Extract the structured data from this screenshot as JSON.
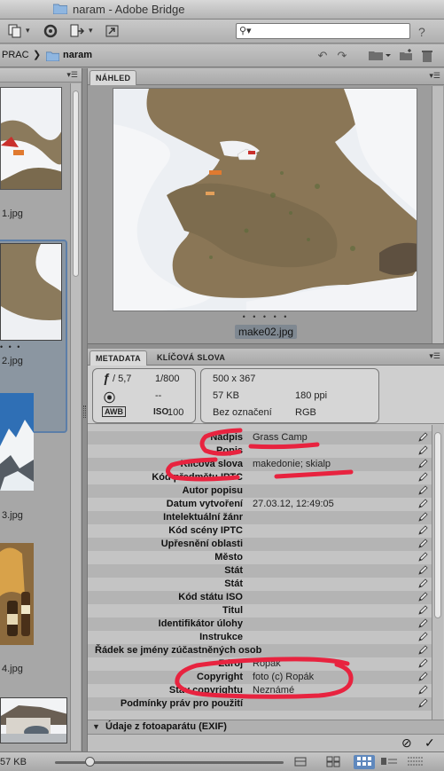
{
  "window": {
    "title": "naram - Adobe Bridge",
    "help_glyph": "?"
  },
  "toolbar": {
    "search_placeholder": "",
    "search_glyph": "⚲▾"
  },
  "path": {
    "parent": "PRAC",
    "separator": "❯",
    "current": "naram"
  },
  "content": {
    "thumbnails": [
      {
        "caption": "1.jpg"
      },
      {
        "caption": "2.jpg"
      },
      {
        "caption": "3.jpg"
      },
      {
        "caption": "4.jpg"
      }
    ],
    "selected_dots": "• • •"
  },
  "preview": {
    "tab_label": "NÁHLED",
    "dots": "• • • • •",
    "caption": "make02.jpg"
  },
  "metadata": {
    "tabs": [
      "METADATA",
      "KLÍČOVÁ SLOVA"
    ],
    "camera": {
      "aperture_icon": "ƒ",
      "aperture": "/ 5,7",
      "shutter": "1/800",
      "metering_icon": "⦿",
      "metering_value": "--",
      "wb_icon": "AWB",
      "iso_label": "ISO",
      "iso_value": "100"
    },
    "file": {
      "dimensions": "500 x 367",
      "size": "57 KB",
      "resolution": "180 ppi",
      "label": "Bez označení",
      "color_mode": "RGB"
    },
    "rows": [
      {
        "label": "Nadpis",
        "value": "Grass Camp"
      },
      {
        "label": "Popis",
        "value": ""
      },
      {
        "label": "Klíčová slova",
        "value": "makedonie; skialp"
      },
      {
        "label": "Kód předmětu IPTC",
        "value": ""
      },
      {
        "label": "Autor popisu",
        "value": ""
      },
      {
        "label": "Datum vytvoření",
        "value": "27.03.12, 12:49:05"
      },
      {
        "label": "Intelektuální žánr",
        "value": ""
      },
      {
        "label": "Kód scény IPTC",
        "value": ""
      },
      {
        "label": "Upřesnění oblasti",
        "value": ""
      },
      {
        "label": "Město",
        "value": ""
      },
      {
        "label": "Stát",
        "value": ""
      },
      {
        "label": "Stát",
        "value": ""
      },
      {
        "label": "Kód státu ISO",
        "value": ""
      },
      {
        "label": "Titul",
        "value": ""
      },
      {
        "label": "Identifikátor úlohy",
        "value": ""
      },
      {
        "label": "Instrukce",
        "value": ""
      },
      {
        "label": "Řádek se jmény zúčastněných osob",
        "value": ""
      },
      {
        "label": "Zdroj",
        "value": "Ropák"
      },
      {
        "label": "Copyright",
        "value": "foto (c) Ropák"
      },
      {
        "label": "Stav copyrightu",
        "value": "Neznámé"
      },
      {
        "label": "Podmínky práv pro použití",
        "value": ""
      }
    ],
    "exif_section": "Údaje z fotoaparátu (EXIF)",
    "cancel_glyph": "⊘",
    "apply_glyph": "✓"
  },
  "status": {
    "size_text": "57 KB",
    "thumb_zoom": 0.15
  },
  "colors": {
    "annotation": "#e8233f",
    "selection": "#5c7ea8"
  }
}
